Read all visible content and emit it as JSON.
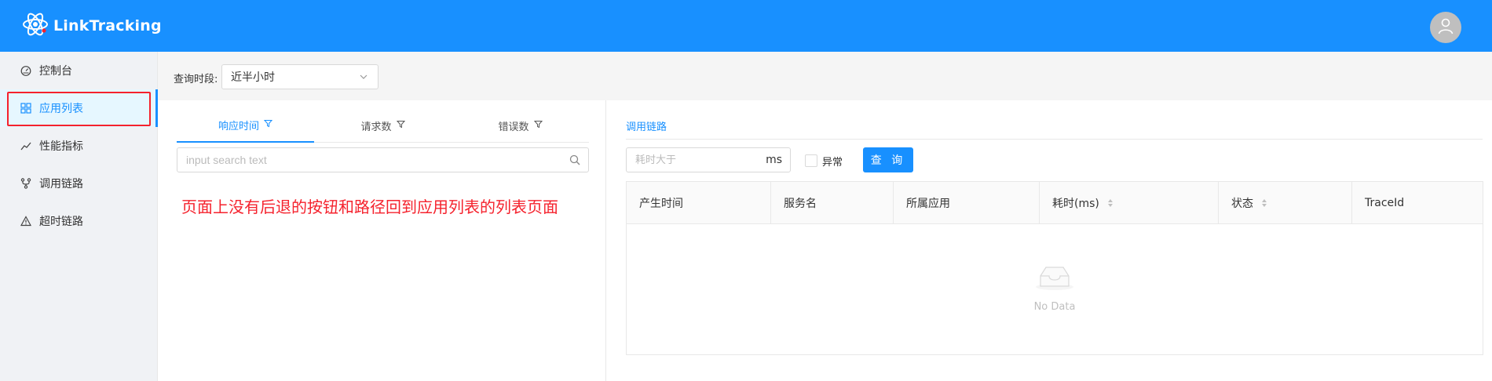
{
  "app": {
    "title": "LinkTracking"
  },
  "colors": {
    "brand": "#1890ff",
    "annotation": "#f5222d"
  },
  "sidebar": {
    "items": [
      {
        "label": "控制台",
        "icon": "dashboard-icon",
        "active": false
      },
      {
        "label": "应用列表",
        "icon": "appstore-icon",
        "active": true
      },
      {
        "label": "性能指标",
        "icon": "line-chart-icon",
        "active": false
      },
      {
        "label": "调用链路",
        "icon": "branches-icon",
        "active": false
      },
      {
        "label": "超时链路",
        "icon": "warning-icon",
        "active": false
      }
    ]
  },
  "filter": {
    "label": "查询时段:",
    "selected": "近半小时"
  },
  "left": {
    "tabs": [
      {
        "label": "响应时间",
        "active": true
      },
      {
        "label": "请求数",
        "active": false
      },
      {
        "label": "错误数",
        "active": false
      }
    ],
    "search_placeholder": "input search text"
  },
  "annotation": "页面上没有后退的按钮和路径回到应用列表的列表页面",
  "right": {
    "title": "调用链路",
    "cost_placeholder": "耗时大于",
    "cost_unit": "ms",
    "abnormal_label": "异常",
    "query_button": "查 询",
    "table": {
      "columns": [
        {
          "label": "产生时间",
          "sortable": false
        },
        {
          "label": "服务名",
          "sortable": false
        },
        {
          "label": "所属应用",
          "sortable": false
        },
        {
          "label": "耗时(ms)",
          "sortable": true
        },
        {
          "label": "状态",
          "sortable": true
        },
        {
          "label": "TraceId",
          "sortable": false
        }
      ],
      "empty_text": "No Data"
    }
  }
}
